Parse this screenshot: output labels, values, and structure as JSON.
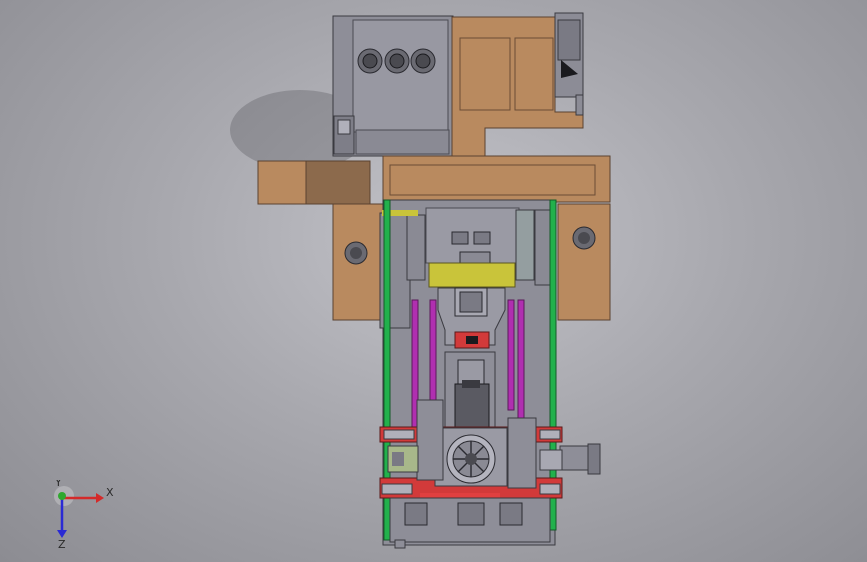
{
  "viewport": {
    "background": "#a9a9af",
    "model_colors": {
      "housing_gray": "#8c8c96",
      "plate_tan": "#b98a5f",
      "plate_tan_dark": "#8c6a4c",
      "rail_green": "#22b14c",
      "rail_magenta": "#b02fb0",
      "sensor_red": "#d23a3a",
      "guard_yellow": "#c9c43a"
    }
  },
  "triad": {
    "x_label": "X",
    "y_label": "Y",
    "z_label": "Z",
    "x_color": "#d42a2a",
    "y_color": "#2fa82f",
    "z_color": "#2a2ad4"
  }
}
